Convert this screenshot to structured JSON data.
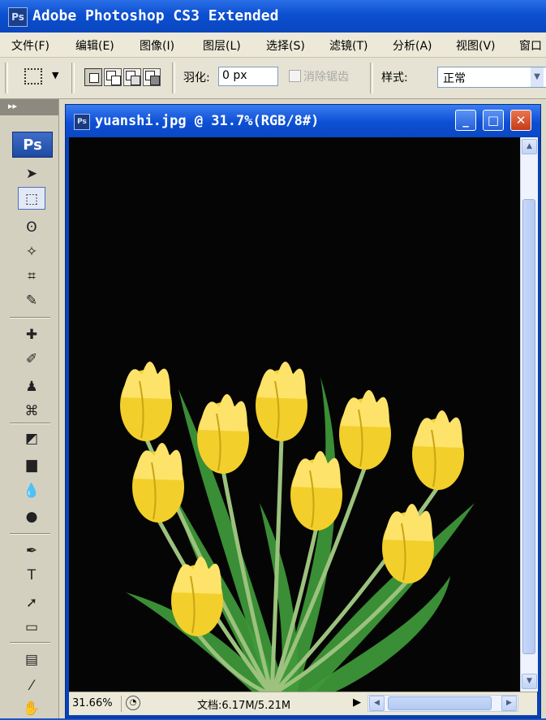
{
  "app": {
    "icon_text": "Ps",
    "title": "Adobe Photoshop CS3 Extended"
  },
  "menu": [
    {
      "label": "文件(F)"
    },
    {
      "label": "编辑(E)"
    },
    {
      "label": "图像(I)"
    },
    {
      "label": "图层(L)"
    },
    {
      "label": "选择(S)"
    },
    {
      "label": "滤镜(T)"
    },
    {
      "label": "分析(A)"
    },
    {
      "label": "视图(V)"
    },
    {
      "label": "窗口"
    }
  ],
  "options_bar": {
    "feather_label": "羽化:",
    "feather_value": "0 px",
    "antialias_label": "消除锯齿",
    "style_label": "样式:",
    "style_value": "正常"
  },
  "toolbox": {
    "logo": "Ps",
    "grip": "▸▸",
    "tools": [
      {
        "name": "move-tool",
        "glyph": "➤"
      },
      {
        "name": "marquee-tool",
        "glyph": "⬚",
        "active": true
      },
      {
        "name": "lasso-tool",
        "glyph": "ʘ"
      },
      {
        "name": "magic-wand-tool",
        "glyph": "✧"
      },
      {
        "name": "crop-tool",
        "glyph": "⌗"
      },
      {
        "name": "slice-tool",
        "glyph": "✎"
      },
      {
        "name": "healing-brush-tool",
        "glyph": "✚"
      },
      {
        "name": "brush-tool",
        "glyph": "✐"
      },
      {
        "name": "clone-stamp-tool",
        "glyph": "♟"
      },
      {
        "name": "history-brush-tool",
        "glyph": "⌘"
      },
      {
        "name": "eraser-tool",
        "glyph": "◩"
      },
      {
        "name": "gradient-tool",
        "glyph": "▆"
      },
      {
        "name": "blur-tool",
        "glyph": "💧"
      },
      {
        "name": "dodge-tool",
        "glyph": "●"
      },
      {
        "name": "pen-tool",
        "glyph": "✒"
      },
      {
        "name": "type-tool",
        "glyph": "T"
      },
      {
        "name": "path-selection-tool",
        "glyph": "➚"
      },
      {
        "name": "shape-tool",
        "glyph": "▭"
      },
      {
        "name": "notes-tool",
        "glyph": "▤"
      },
      {
        "name": "eyedropper-tool",
        "glyph": "⁄"
      },
      {
        "name": "hand-tool",
        "glyph": "✋"
      }
    ]
  },
  "document": {
    "icon_text": "Ps",
    "title": "yuanshi.jpg @ 31.7%(RGB/8#)",
    "minimize": "_",
    "maximize": "□",
    "close": "✕"
  },
  "status": {
    "zoom": "31.66%",
    "doc_info": "文档:6.17M/5.21M",
    "play": "▶"
  },
  "colors": {
    "petal": "#f2cf2a",
    "petal_light": "#fde36a",
    "leaf": "#3f9a3a",
    "stem": "#9cc27d",
    "canvas_bg": "#050505"
  }
}
